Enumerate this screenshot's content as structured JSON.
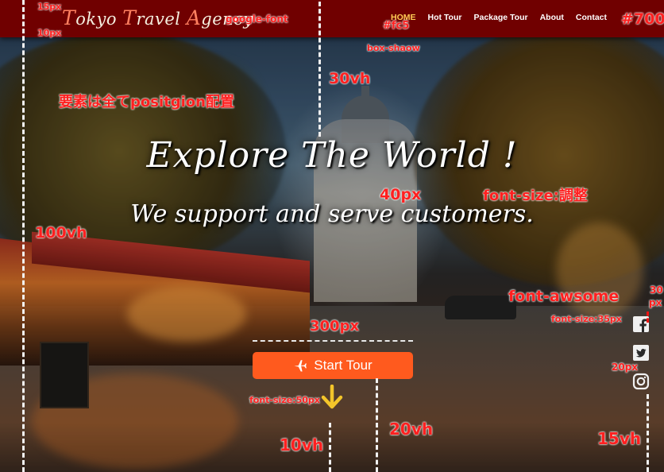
{
  "header": {
    "logo": {
      "c1": "T",
      "r1": "okyo ",
      "c2": "T",
      "r2": "ravel ",
      "c3": "A",
      "r3": "gency"
    },
    "nav": [
      "HOME",
      "Hot Tour",
      "Package Tour",
      "About",
      "Contact"
    ],
    "active_nav": "HOME",
    "background_color": "#700000",
    "active_color": "#fc5"
  },
  "hero": {
    "title": "Explore The World !",
    "subtitle": "We support and serve customers.",
    "button_label": "Start Tour",
    "button_icon": "plane-icon",
    "button_color": "#ff5a1e",
    "scroll_icon": "arrow-down-icon"
  },
  "social": [
    "facebook-icon",
    "twitter-icon",
    "instagram-icon"
  ],
  "annotations": {
    "a1": "15px",
    "a2": "10px",
    "a3": "google-font",
    "a4": "#fc5",
    "a5": "#700",
    "a6": "box-shaow",
    "a7": "30vh",
    "a8": "要素は全てpositgion配置",
    "a9": "40px",
    "a10": "font-size:調整",
    "a11": "100vh",
    "a12": "font-awsome",
    "a13": "30",
    "a14": "px",
    "a15": "font-size:35px",
    "a16": "300px",
    "a17": "20px",
    "a18": "font-size:50px",
    "a19": "20vh",
    "a20": "10vh",
    "a21": "15vh"
  }
}
